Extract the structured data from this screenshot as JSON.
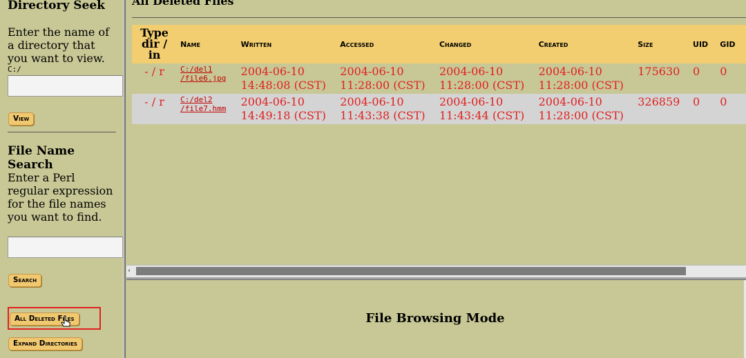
{
  "left": {
    "dir_title": "Directory Seek",
    "dir_prompt": "Enter the name of a directory that you want to view.",
    "dir_value": "C:/",
    "view_button": "View",
    "fname_title": "File Name Search",
    "fname_prompt": "Enter a Perl regular expression for the file names you want to find.",
    "search_button": "Search",
    "all_deleted_button": "All Deleted Files",
    "expand_button": "Expand Directories"
  },
  "main": {
    "title": "All Deleted Files",
    "columns": {
      "type": [
        "Type",
        "dir / in"
      ],
      "name": "Name",
      "written": "Written",
      "accessed": "Accessed",
      "changed": "Changed",
      "created": "Created",
      "size": "Size",
      "uid": "UID",
      "gid": "GID"
    },
    "rows": [
      {
        "type": "- / r",
        "name_line1": "C:/del1",
        "name_line2": "/file6.jpg",
        "written": [
          "2004-06-10",
          "14:48:08 (CST)"
        ],
        "accessed": [
          "2004-06-10",
          "11:28:00 (CST)"
        ],
        "changed": [
          "2004-06-10",
          "11:28:00 (CST)"
        ],
        "created": [
          "2004-06-10",
          "11:28:00 (CST)"
        ],
        "size": "175630",
        "uid": "0",
        "gid": "0"
      },
      {
        "type": "- / r",
        "name_line1": "C:/del2",
        "name_line2": "/file7.hmm",
        "written": [
          "2004-06-10",
          "14:49:18 (CST)"
        ],
        "accessed": [
          "2004-06-10",
          "11:43:38 (CST)"
        ],
        "changed": [
          "2004-06-10",
          "11:43:44 (CST)"
        ],
        "created": [
          "2004-06-10",
          "11:28:00 (CST)"
        ],
        "size": "326859",
        "uid": "0",
        "gid": "0"
      }
    ]
  },
  "bottom": {
    "mode_title": "File Browsing Mode"
  },
  "colors": {
    "background": "#c8c896",
    "header": "#f2ce70",
    "button": "#f0c870",
    "red_text": "#e02020",
    "highlight_border": "#e02020"
  }
}
